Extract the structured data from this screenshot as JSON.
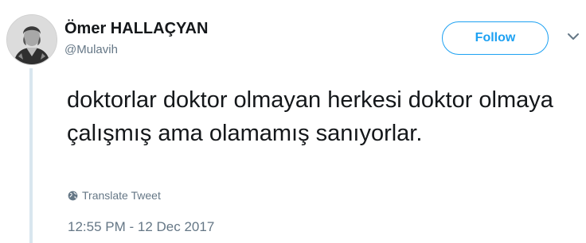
{
  "tweet": {
    "author": {
      "display_name": "Ömer HALLAÇYAN",
      "handle": "@Mulavih",
      "avatar_icon": "portrait-avatar"
    },
    "follow_label": "Follow",
    "menu_icon": "chevron-down-icon",
    "text": "doktorlar doktor olmayan herkesi doktor olmaya çalışmış ama olamamış sanıyorlar.",
    "translate_icon": "globe-icon",
    "translate_label": "Translate Tweet",
    "timestamp": "12:55 PM - 12 Dec 2017"
  },
  "colors": {
    "accent": "#1da1f2",
    "text": "#14171a",
    "secondary_text": "#657786",
    "thread_line": "#d9e6ef"
  }
}
